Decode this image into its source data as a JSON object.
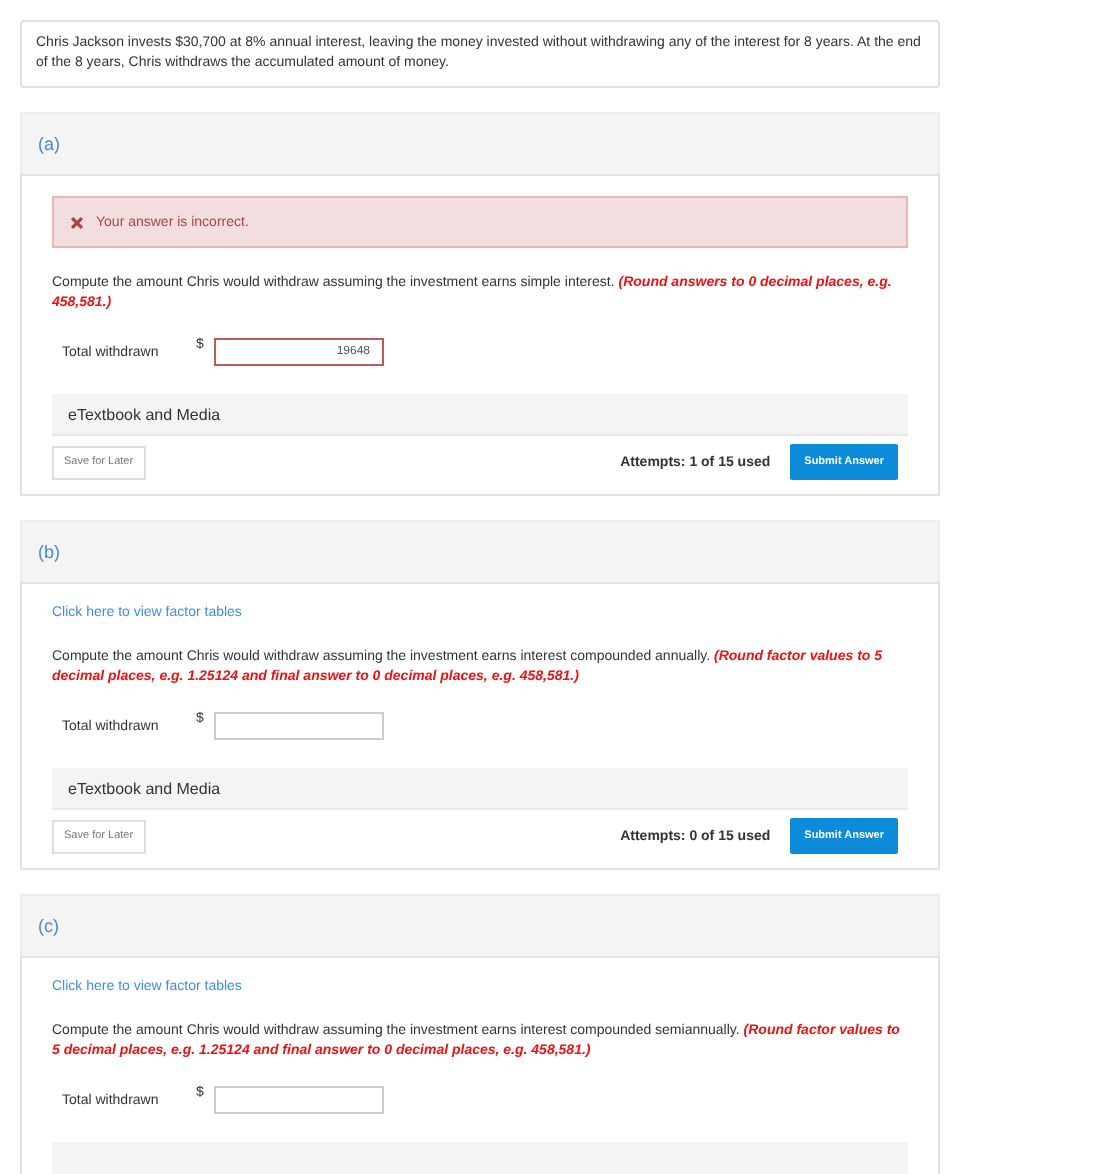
{
  "question": "Chris Jackson invests $30,700 at 8% annual interest, leaving the money invested without withdrawing any of the interest for 8 years. At the end of the 8 years, Chris withdraws the accumulated amount of money.",
  "parts": [
    {
      "label": "(a)",
      "feedback": {
        "text": "Your answer is incorrect.",
        "correct": false
      },
      "prompt": "Compute the amount Chris would withdraw assuming the investment earns simple interest.",
      "note": "(Round answers to 0 decimal places, e.g. 458,581.)",
      "field_label": "Total withdrawn",
      "currency": "$",
      "value": "19648",
      "etextbook": "eTextbook and Media",
      "save": "Save for Later",
      "attempts": "Attempts: 1 of 15 used",
      "submit": "Submit Answer"
    },
    {
      "label": "(b)",
      "link": "Click here to view factor tables",
      "prompt": "Compute the amount Chris would withdraw assuming the investment earns interest compounded annually.",
      "note": "(Round factor values to 5 decimal places, e.g. 1.25124 and final answer to 0 decimal places, e.g. 458,581.)",
      "field_label": "Total withdrawn",
      "currency": "$",
      "etextbook": "eTextbook and Media",
      "save": "Save for Later",
      "attempts": "Attempts: 0 of 15 used",
      "submit": "Submit Answer"
    },
    {
      "label": "(c)",
      "link": "Click here to view factor tables",
      "prompt": "Compute the amount Chris would withdraw assuming the investment earns interest compounded semiannually.",
      "note": "(Round factor values to 5 decimal places, e.g. 1.25124 and final answer to 0 decimal places, e.g. 458,581.)",
      "field_label": "Total withdrawn",
      "currency": "$"
    }
  ]
}
